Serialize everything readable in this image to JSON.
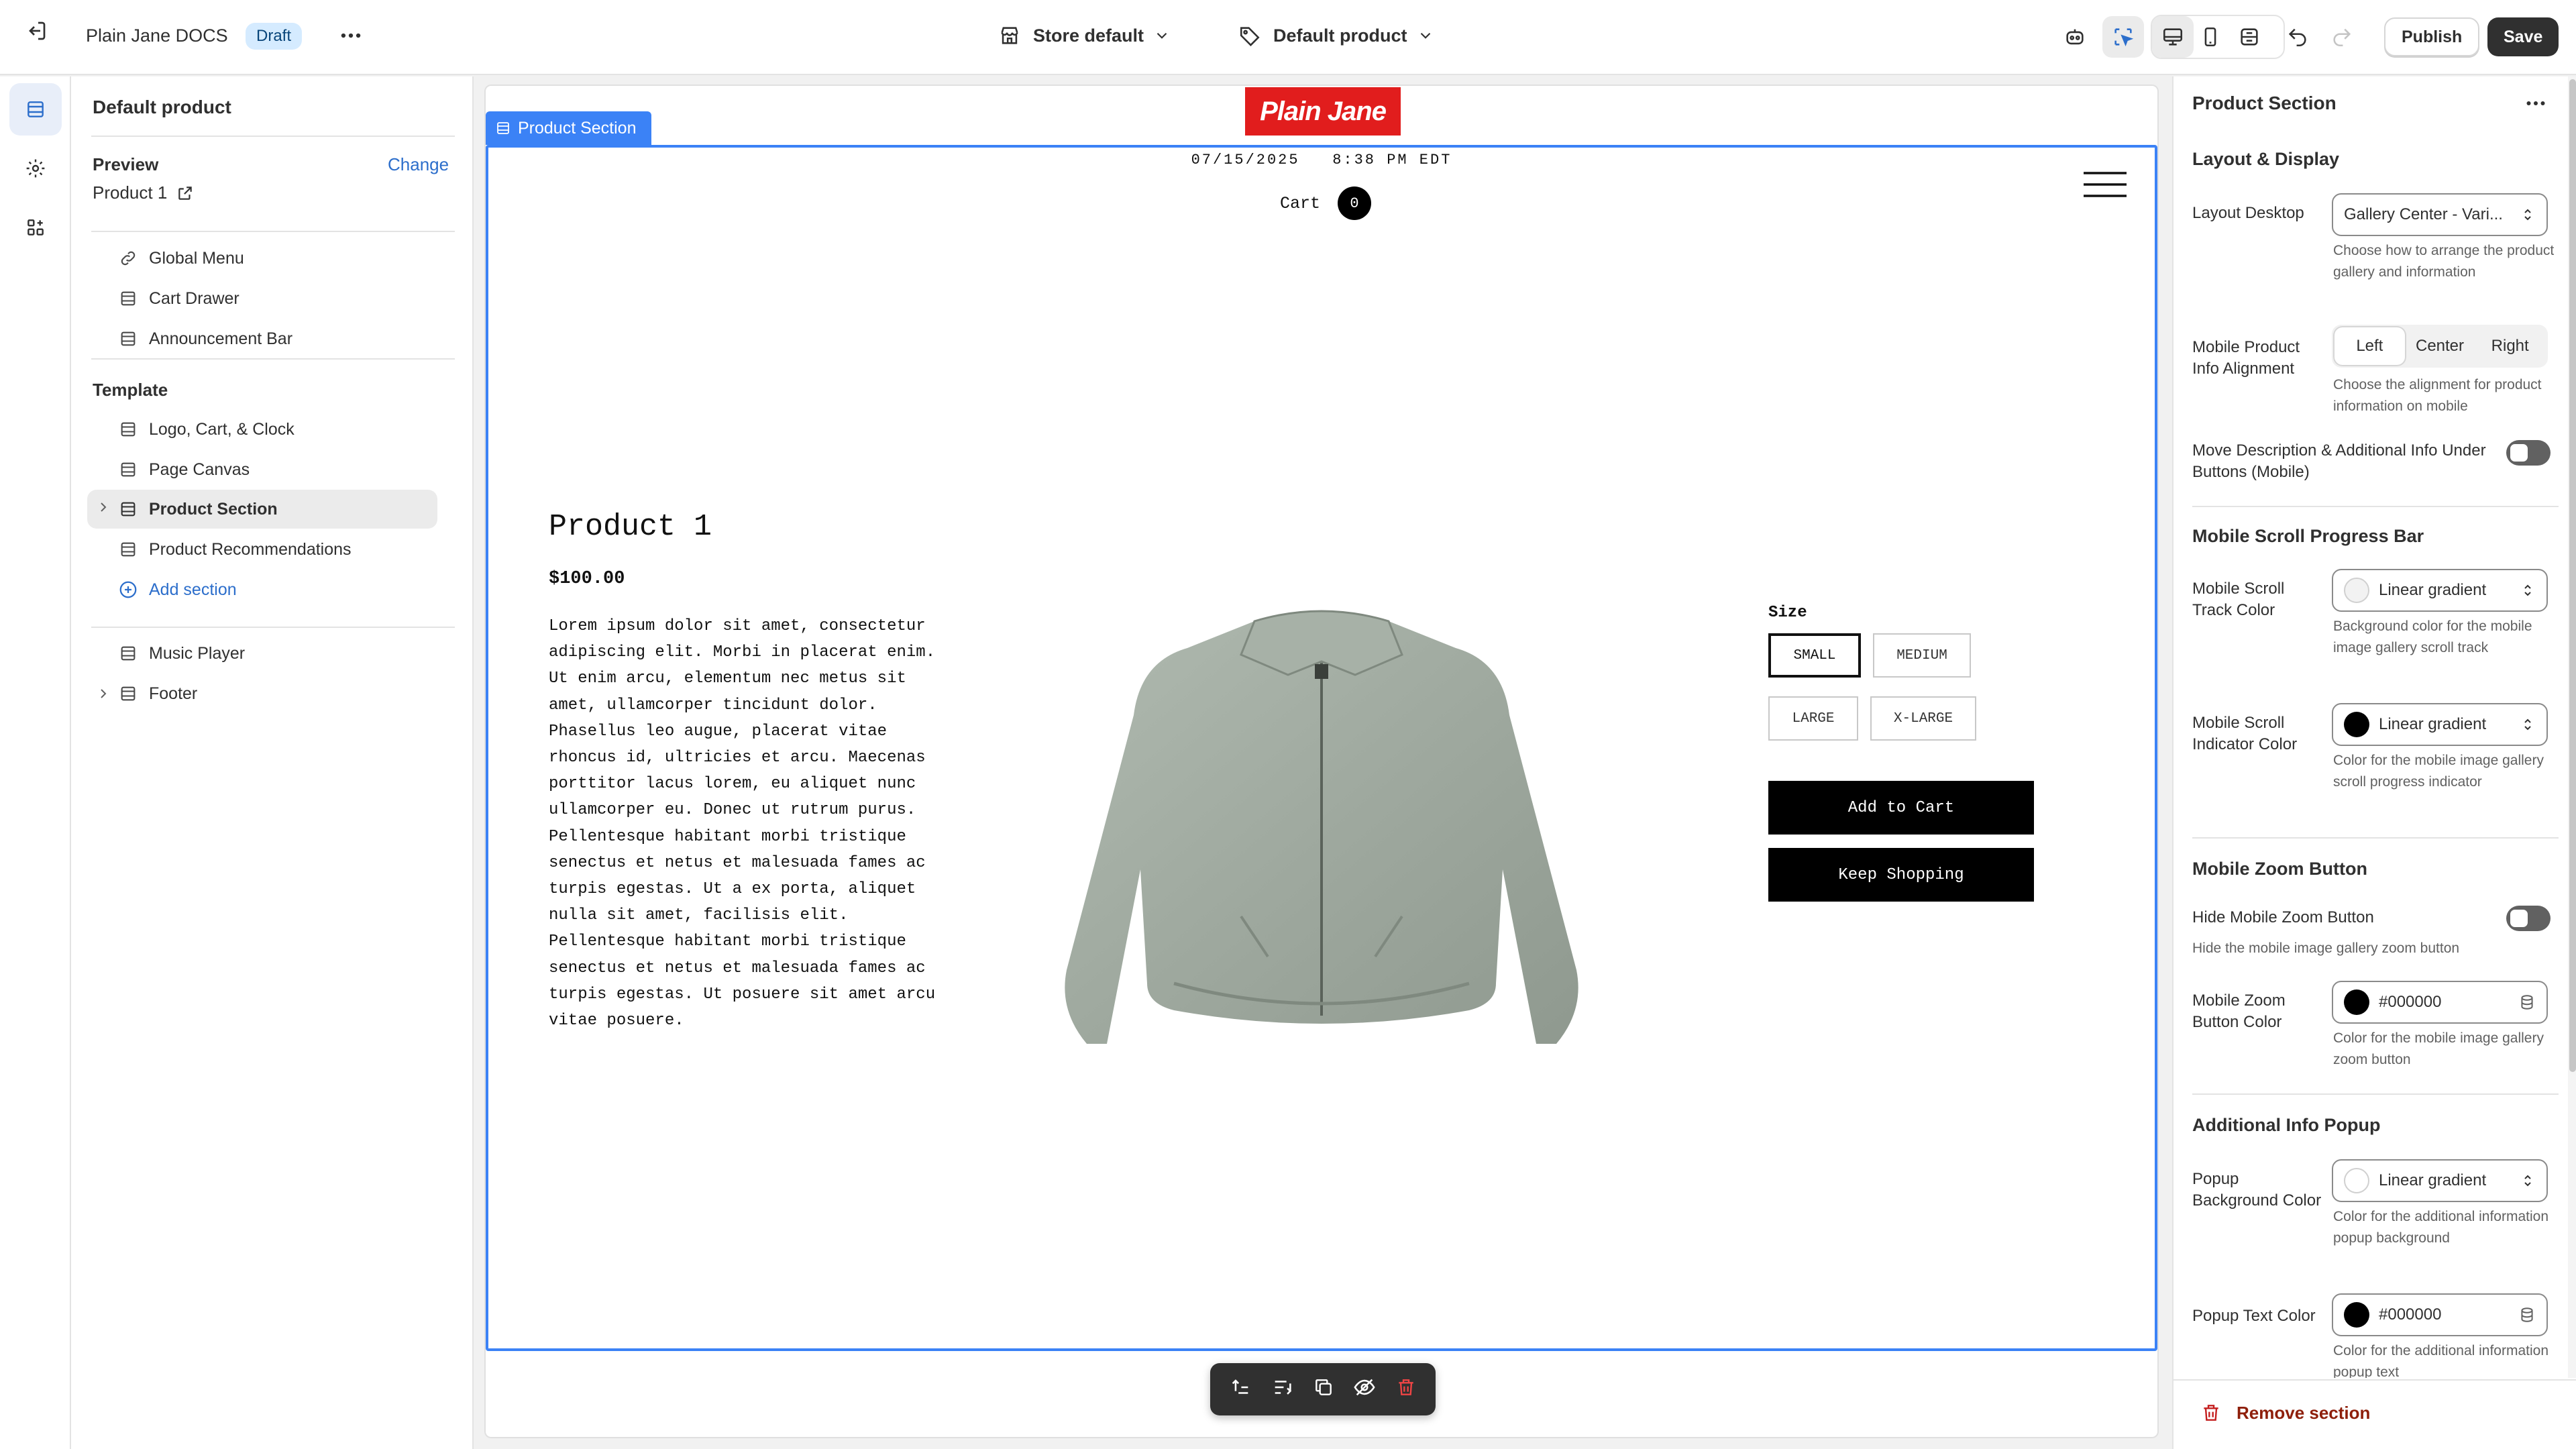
{
  "topbar": {
    "store_title": "Plain Jane DOCS",
    "status_badge": "Draft",
    "store_picker": "Store default",
    "template_picker": "Default product",
    "publish_label": "Publish",
    "save_label": "Save"
  },
  "left_panel": {
    "title": "Default product",
    "preview_label": "Preview",
    "change_label": "Change",
    "preview_product": "Product 1",
    "header_items": [
      {
        "label": "Global Menu",
        "icon": "link-icon"
      },
      {
        "label": "Cart Drawer",
        "icon": "section-icon"
      },
      {
        "label": "Announcement Bar",
        "icon": "section-icon"
      }
    ],
    "template_heading": "Template",
    "template_items": [
      {
        "label": "Logo, Cart, & Clock"
      },
      {
        "label": "Page Canvas"
      },
      {
        "label": "Product Section"
      },
      {
        "label": "Product Recommendations"
      }
    ],
    "add_section_label": "Add section",
    "footer_items": [
      {
        "label": "Music Player"
      },
      {
        "label": "Footer"
      }
    ]
  },
  "canvas": {
    "selected_section_tag": "Product Section",
    "logo_text": "Plain Jane",
    "clock_text": "07/15/2025   8:38 PM EDT",
    "cart_label": "Cart",
    "cart_count": "0",
    "product_title": "Product 1",
    "price": "$100.00",
    "description": "Lorem ipsum dolor sit amet, consectetur adipiscing elit. Morbi in placerat enim. Ut enim arcu, elementum nec metus sit amet, ullamcorper tincidunt dolor. Phasellus leo augue, placerat vitae rhoncus id, ultricies et arcu. Maecenas porttitor lacus lorem, eu aliquet nunc ullamcorper eu. Donec ut rutrum purus. Pellentesque habitant morbi tristique senectus et netus et malesuada fames ac turpis egestas. Ut a ex porta, aliquet nulla sit amet, facilisis elit. Pellentesque habitant morbi tristique senectus et netus et malesuada fames ac turpis egestas. Ut posuere sit amet arcu vitae posuere.",
    "size_label": "Size",
    "sizes": [
      "SMALL",
      "MEDIUM",
      "LARGE",
      "X-LARGE"
    ],
    "add_to_cart_label": "Add to Cart",
    "keep_shopping_label": "Keep Shopping"
  },
  "right_panel": {
    "title": "Product Section",
    "layout_heading": "Layout & Display",
    "layout_desktop_label": "Layout Desktop",
    "layout_desktop_value": "Gallery Center - Vari...",
    "layout_desktop_help": "Choose how to arrange the product gallery and information",
    "mobile_align_label": "Mobile Product Info Alignment",
    "mobile_align_options": [
      "Left",
      "Center",
      "Right"
    ],
    "mobile_align_help": "Choose the alignment for product information on mobile",
    "move_desc_label": "Move Description & Additional Info Under Buttons (Mobile)",
    "scroll_heading": "Mobile Scroll Progress Bar",
    "track_color_label": "Mobile Scroll Track Color",
    "track_color_value": "Linear gradient",
    "track_color_help": "Background color for the mobile image gallery scroll track",
    "indicator_color_label": "Mobile Scroll Indicator Color",
    "indicator_color_value": "Linear gradient",
    "indicator_color_help": "Color for the mobile image gallery scroll progress indicator",
    "zoom_heading": "Mobile Zoom Button",
    "hide_zoom_label": "Hide Mobile Zoom Button",
    "hide_zoom_help": "Hide the mobile image gallery zoom button",
    "zoom_color_label": "Mobile Zoom Button Color",
    "zoom_color_value": "#000000",
    "zoom_color_help": "Color for the mobile image gallery zoom button",
    "popup_heading": "Additional Info Popup",
    "popup_bg_label": "Popup Background Color",
    "popup_bg_value": "Linear gradient",
    "popup_bg_help": "Color for the additional information popup background",
    "popup_text_label": "Popup Text Color",
    "popup_text_value": "#000000",
    "popup_text_help": "Color for the additional information popup text",
    "remove_label": "Remove section"
  },
  "colors": {
    "accent_blue": "#2c6ecb",
    "logo_red": "#e11d1d",
    "critical_red": "#8e1f0b",
    "jacket": "#a3ada3"
  }
}
